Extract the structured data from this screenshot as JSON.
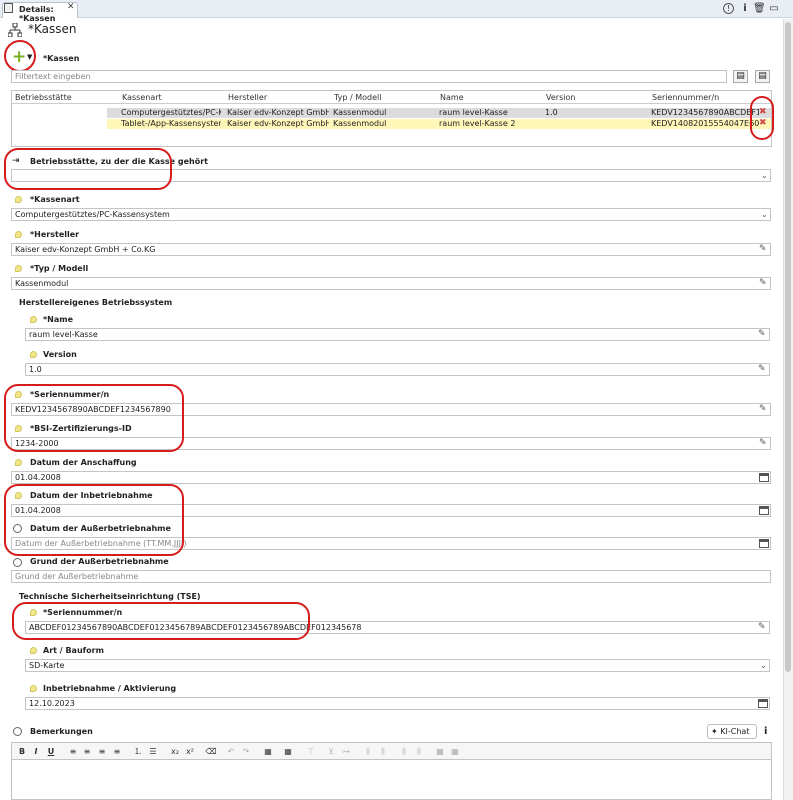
{
  "tab": {
    "title": "Details: *Kassen"
  },
  "header": {
    "title": "*Kassen"
  },
  "kassen": {
    "section_label": "*Kassen",
    "filter_placeholder": "Filtertext eingeben",
    "columns": [
      "Betriebsstätte",
      "Kassenart",
      "Hersteller",
      "Typ / Modell",
      "Name",
      "Version",
      "Seriennummer/n"
    ],
    "rows": [
      {
        "betriebsstaette": "",
        "kassenart": "Computergestütztes/PC-K...",
        "hersteller": "Kaiser edv-Konzept GmbH ...",
        "typ": "Kassenmodul",
        "name": "raum level-Kasse",
        "version": "1.0",
        "seriennummer": "KEDV1234567890ABCDEF1..."
      },
      {
        "betriebsstaette": "",
        "kassenart": "Tablet-/App-Kassensystem",
        "hersteller": "Kaiser edv-Konzept GmbH ...",
        "typ": "Kassenmodul",
        "name": "raum level-Kasse 2",
        "version": "",
        "seriennummer": "KEDV14082015554047E6008..."
      }
    ]
  },
  "form": {
    "betriebsstaette": {
      "label": "Betriebsstätte, zu der die Kasse gehört",
      "value": ""
    },
    "kassenart": {
      "label": "*Kassenart",
      "value": "Computergestütztes/PC-Kassensystem"
    },
    "hersteller": {
      "label": "*Hersteller",
      "value": "Kaiser edv-Konzept GmbH + Co.KG"
    },
    "typ": {
      "label": "*Typ / Modell",
      "value": "Kassenmodul"
    },
    "betriebssystem_group": "Herstellereigenes Betriebssystem",
    "name": {
      "label": "*Name",
      "value": "raum level-Kasse"
    },
    "version": {
      "label": "Version",
      "value": "1.0"
    },
    "seriennummer": {
      "label": "*Seriennummer/n",
      "value": "KEDV1234567890ABCDEF1234567890"
    },
    "bsi": {
      "label": "*BSI-Zertifizierungs-ID",
      "value": "1234-2000"
    },
    "anschaffung": {
      "label": "Datum der Anschaffung",
      "value": "01.04.2008"
    },
    "inbetriebnahme": {
      "label": "Datum der Inbetriebnahme",
      "value": "01.04.2008"
    },
    "ausserbetriebnahme": {
      "label": "Datum der Außerbetriebnahme",
      "placeholder": "Datum der Außerbetriebnahme (TT.MM.JJJJ)"
    },
    "grund": {
      "label": "Grund der Außerbetriebnahme",
      "placeholder": "Grund der Außerbetriebnahme"
    },
    "tse_group": "Technische Sicherheitseinrichtung (TSE)",
    "tse_seriennummer": {
      "label": "*Seriennummer/n",
      "value": "ABCDEF01234567890ABCDEF0123456789ABCDEF0123456789ABCDEF012345678"
    },
    "art": {
      "label": "Art / Bauform",
      "value": "SD-Karte"
    },
    "aktivierung": {
      "label": "Inbetriebnahme / Aktivierung",
      "value": "12.10.2023"
    },
    "bemerkungen": {
      "label": "Bemerkungen"
    },
    "kichat_label": "KI-Chat"
  },
  "editor_toolbar": [
    "B",
    "I",
    "U"
  ],
  "colors": {
    "selected_row": "#dcdcdc",
    "highlight_row": "#fff7b8",
    "annotation": "#d61c1c",
    "add_icon": "#7ab020"
  }
}
